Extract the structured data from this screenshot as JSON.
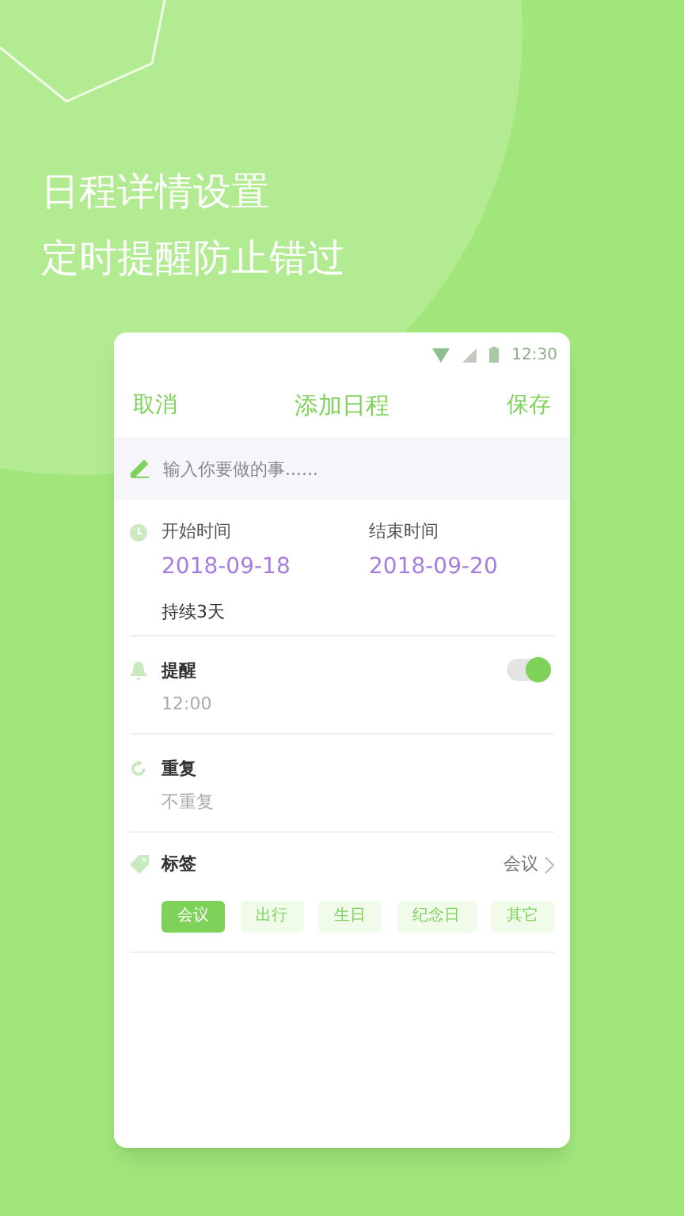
{
  "headline": [
    "日程详情设置",
    "定时提醒防止错过"
  ],
  "status_bar": {
    "time": "12:30"
  },
  "header": {
    "cancel": "取消",
    "title": "添加日程",
    "save": "保存"
  },
  "task_field": {
    "placeholder": "输入你要做的事......"
  },
  "time": {
    "start_label": "开始时间",
    "start_value": "2018-09-18",
    "end_label": "结束时间",
    "end_value": "2018-09-20",
    "duration": "持续3天"
  },
  "reminder": {
    "label": "提醒",
    "value": "12:00",
    "on": true
  },
  "repeat": {
    "label": "重复",
    "value": "不重复"
  },
  "tags": {
    "label": "标签",
    "value": "会议",
    "items": [
      {
        "label": "会议",
        "selected": true
      },
      {
        "label": "出行",
        "selected": false
      },
      {
        "label": "生日",
        "selected": false
      },
      {
        "label": "纪念日",
        "selected": false
      },
      {
        "label": "其它",
        "selected": false
      }
    ]
  }
}
